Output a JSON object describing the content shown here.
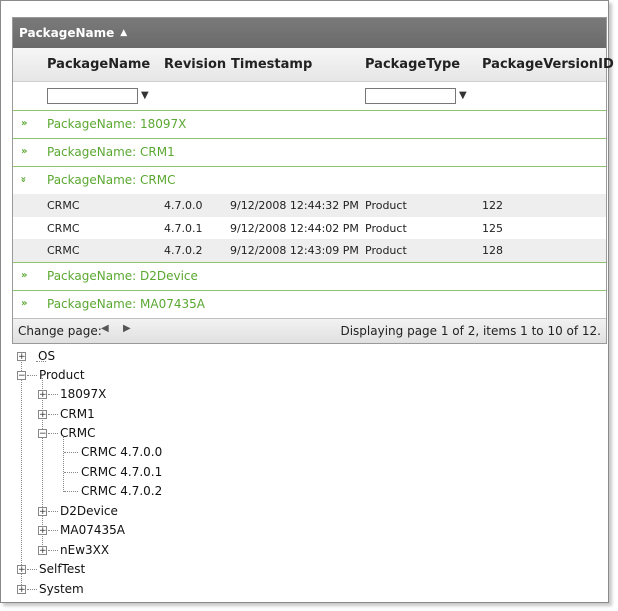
{
  "grid": {
    "group_header": "PackageName",
    "columns": [
      "PackageName",
      "Revision",
      "Timestamp",
      "PackageType",
      "PackageVersionID"
    ],
    "groups": [
      {
        "label": "PackageName: 18097X",
        "expanded": false
      },
      {
        "label": "PackageName: CRM1",
        "expanded": false
      },
      {
        "label": "PackageName: CRMC",
        "expanded": true
      },
      {
        "label": "PackageName: D2Device",
        "expanded": false
      },
      {
        "label": "PackageName: MA07435A",
        "expanded": false
      }
    ],
    "rows": [
      [
        "CRMC",
        "4.7.0.0",
        "9/12/2008 12:44:32 PM",
        "Product",
        "122"
      ],
      [
        "CRMC",
        "4.7.0.1",
        "9/12/2008 12:44:02 PM",
        "Product",
        "125"
      ],
      [
        "CRMC",
        "4.7.0.2",
        "9/12/2008 12:43:09 PM",
        "Product",
        "128"
      ]
    ],
    "pager": {
      "change_page": "Change page:",
      "info": "Displaying page 1 of 2, items 1 to 10 of 12."
    }
  },
  "tree": {
    "nodes": [
      "OS",
      "Product",
      "18097X",
      "CRM1",
      "CRMC",
      "CRMC 4.7.0.0",
      "CRMC 4.7.0.1",
      "CRMC 4.7.0.2",
      "D2Device",
      "MA07435A",
      "nEw3XX",
      "SelfTest",
      "System"
    ]
  },
  "colors": {
    "accent_green": "#5aa832",
    "header_gray": "#707070"
  }
}
